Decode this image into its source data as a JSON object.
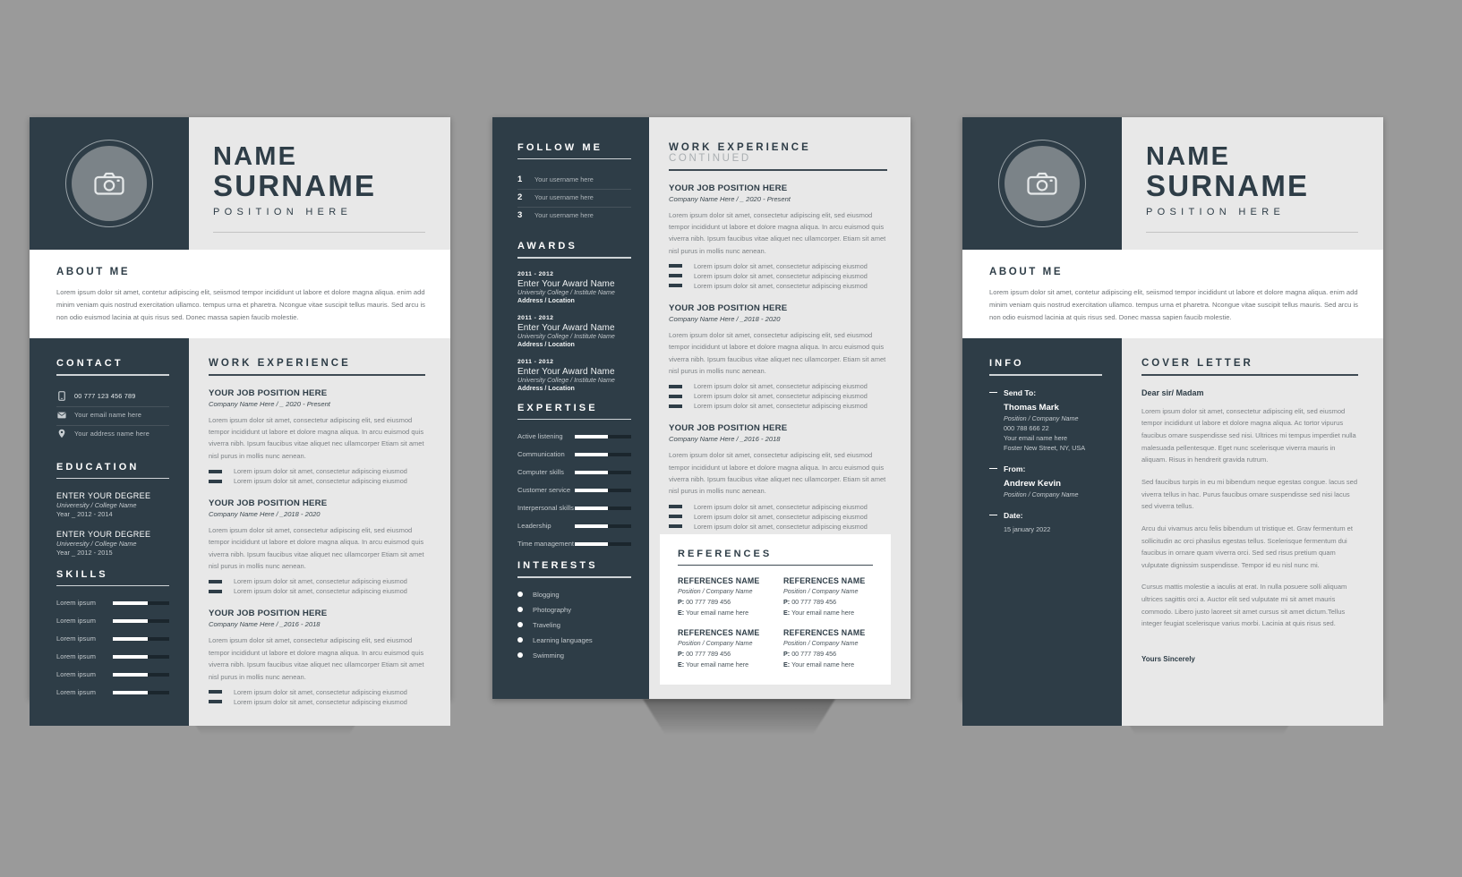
{
  "theme": {
    "dark": "#2e3d47",
    "light": "#e8e8e8",
    "white": "#ffffff",
    "background": "#9a9a9a",
    "accent_muted": "#7c8185"
  },
  "header": {
    "name_line1": "NAME",
    "name_line2": "SURNAME",
    "position": "POSITION HERE",
    "photo_icon": "camera-icon"
  },
  "about": {
    "title": "ABOUT ME",
    "body": "Lorem ipsum dolor sit amet, contetur adipiscing elit, seiismod tempor incididunt ut labore et dolore magna aliqua. enim add minim veniam quis nostrud exercitation ullamco. tempus urna et pharetra. Ncongue vitae suscipit tellus mauris. Sed arcu is non odio euismod lacinia at quis risus sed. Donec massa sapien faucib molestie."
  },
  "page1": {
    "contact": {
      "title": "CONTACT",
      "items": [
        {
          "icon": "phone-icon",
          "text": "00 777 123 456 789"
        },
        {
          "icon": "email-icon",
          "text": "Your email name here"
        },
        {
          "icon": "location-icon",
          "text": "Your address name here"
        }
      ]
    },
    "education": {
      "title": "EDUCATION",
      "items": [
        {
          "degree": "ENTER YOUR DEGREE",
          "school": "Univeresity / College Name",
          "year": "Year _ 2012 - 2014"
        },
        {
          "degree": "ENTER YOUR DEGREE",
          "school": "Univeresity / College Name",
          "year": "Year _ 2012 - 2015"
        }
      ]
    },
    "skills": {
      "title": "SKILLS",
      "items": [
        {
          "label": "Lorem ipsum",
          "value": 62
        },
        {
          "label": "Lorem ipsum",
          "value": 62
        },
        {
          "label": "Lorem ipsum",
          "value": 62
        },
        {
          "label": "Lorem ipsum",
          "value": 62
        },
        {
          "label": "Lorem ipsum",
          "value": 62
        },
        {
          "label": "Lorem ipsum",
          "value": 62
        }
      ]
    },
    "work": {
      "title": "WORK EXPERIENCE",
      "jobs": [
        {
          "title": "YOUR JOB POSITION HERE",
          "meta": "Company Name Here / _ 2020 - Present",
          "body": "Lorem ipsum dolor sit amet, consectetur adipiscing elit, sed eiusmod tempor incididunt ut labore et dolore magna aliqua. In arcu  euismod quis viverra nibh. Ipsum faucibus vitae aliquet nec ullamcorper Etiam sit amet nisl purus in mollis nunc aenean.",
          "bullets": [
            "Lorem ipsum dolor sit amet, consectetur adipiscing eiusmod",
            "Lorem ipsum dolor sit amet, consectetur adipiscing eiusmod"
          ]
        },
        {
          "title": "YOUR JOB POSITION HERE",
          "meta": "Company Name Here / _2018 - 2020",
          "body": "Lorem ipsum dolor sit amet, consectetur adipiscing elit, sed eiusmod tempor incididunt ut labore et dolore magna aliqua. In arcu  euismod quis viverra nibh. Ipsum faucibus vitae aliquet nec ullamcorper Etiam sit amet nisl purus in mollis nunc aenean.",
          "bullets": [
            "Lorem ipsum dolor sit amet, consectetur adipiscing eiusmod",
            "Lorem ipsum dolor sit amet, consectetur adipiscing eiusmod"
          ]
        },
        {
          "title": "YOUR JOB POSITION HERE",
          "meta": "Company Name Here / _2016 - 2018",
          "body": "Lorem ipsum dolor sit amet, consectetur adipiscing elit, sed eiusmod tempor incididunt ut labore et dolore magna aliqua. In arcu  euismod quis viverra nibh. Ipsum faucibus vitae aliquet nec ullamcorper Etiam sit amet nisl purus in mollis nunc aenean.",
          "bullets": [
            "Lorem ipsum dolor sit amet, consectetur adipiscing eiusmod",
            "Lorem ipsum dolor sit amet, consectetur adipiscing eiusmod"
          ]
        }
      ]
    }
  },
  "page2": {
    "follow": {
      "title": "FOLLOW ME",
      "items": [
        {
          "num": "1",
          "text": "Your username here"
        },
        {
          "num": "2",
          "text": "Your username here"
        },
        {
          "num": "3",
          "text": "Your username here"
        }
      ]
    },
    "awards": {
      "title": "AWARDS",
      "items": [
        {
          "years": "2011 - 2012",
          "name": "Enter Your Award Name",
          "school": "University  College / Institute Name",
          "location": "Address / Location"
        },
        {
          "years": "2011 - 2012",
          "name": "Enter Your Award Name",
          "school": "University  College / Institute Name",
          "location": "Address / Location"
        },
        {
          "years": "2011 - 2012",
          "name": "Enter Your Award Name",
          "school": "University  College / Institute Name",
          "location": "Address / Location"
        }
      ]
    },
    "expertise": {
      "title": "EXPERTISE",
      "items": [
        {
          "label": "Active listening",
          "value": 58
        },
        {
          "label": "Communication",
          "value": 58
        },
        {
          "label": "Computer skills",
          "value": 58
        },
        {
          "label": "Customer service",
          "value": 58
        },
        {
          "label": "Interpersonal skills",
          "value": 58
        },
        {
          "label": "Leadership",
          "value": 58
        },
        {
          "label": "Time management",
          "value": 58
        }
      ]
    },
    "interests": {
      "title": "INTERESTS",
      "items": [
        "Blogging",
        "Photography",
        "Traveling",
        "Learning languages",
        "Swimming"
      ]
    },
    "work": {
      "title": "WORK EXPERIENCE",
      "title_suffix": "CONTINUED",
      "jobs": [
        {
          "title": "YOUR JOB POSITION HERE",
          "meta": "Company Name Here / _ 2020 - Present",
          "body": "Lorem ipsum dolor sit amet, consectetur adipiscing elit, sed eiusmod tempor incididunt ut labore et dolore magna aliqua. In arcu  euismod quis viverra nibh. Ipsum faucibus vitae aliquet nec ullamcorper. Etiam sit amet nisl purus in mollis nunc aenean.",
          "bullets": [
            "Lorem ipsum dolor sit amet, consectetur adipiscing eiusmod",
            "Lorem ipsum dolor sit amet, consectetur adipiscing eiusmod",
            "Lorem ipsum dolor sit amet, consectetur adipiscing eiusmod"
          ]
        },
        {
          "title": "YOUR JOB POSITION HERE",
          "meta": "Company Name Here / _2018 - 2020",
          "body": "Lorem ipsum dolor sit amet, consectetur adipiscing elit, sed eiusmod tempor incididunt ut labore et dolore magna aliqua. In arcu  euismod quis viverra nibh. Ipsum faucibus vitae aliquet nec ullamcorper. Etiam sit amet nisl purus in mollis nunc aenean.",
          "bullets": [
            "Lorem ipsum dolor sit amet, consectetur adipiscing eiusmod",
            "Lorem ipsum dolor sit amet, consectetur adipiscing eiusmod",
            "Lorem ipsum dolor sit amet, consectetur adipiscing eiusmod"
          ]
        },
        {
          "title": "YOUR JOB POSITION HERE",
          "meta": "Company Name Here / _2016 - 2018",
          "body": "Lorem ipsum dolor sit amet, consectetur adipiscing elit, sed eiusmod tempor incididunt ut labore et dolore magna aliqua. In arcu  euismod quis viverra nibh. Ipsum faucibus vitae aliquet nec ullamcorper. Etiam sit amet nisl purus in mollis nunc aenean.",
          "bullets": [
            "Lorem ipsum dolor sit amet, consectetur adipiscing eiusmod",
            "Lorem ipsum dolor sit amet, consectetur adipiscing eiusmod",
            "Lorem ipsum dolor sit amet, consectetur adipiscing eiusmod"
          ]
        }
      ]
    },
    "references": {
      "title": "REFERENCES",
      "items": [
        {
          "name": "REFERENCES NAME",
          "position": "Position / Company Name",
          "phone_label": "P:",
          "phone": "00 777 789 456",
          "email_label": "E:",
          "email": "Your email name here"
        },
        {
          "name": "REFERENCES NAME",
          "position": "Position / Company Name",
          "phone_label": "P:",
          "phone": "00 777 789 456",
          "email_label": "E:",
          "email": "Your email name here"
        },
        {
          "name": "REFERENCES NAME",
          "position": "Position / Company Name",
          "phone_label": "P:",
          "phone": "00 777 789 456",
          "email_label": "E:",
          "email": "Your email name here"
        },
        {
          "name": "REFERENCES NAME",
          "position": "Position / Company Name",
          "phone_label": "P:",
          "phone": "00 777 789 456",
          "email_label": "E:",
          "email": "Your email name here"
        }
      ]
    }
  },
  "page3": {
    "info": {
      "title": "INFO",
      "send_to_label": "Send To:",
      "send_to_name": "Thomas Mark",
      "send_to_position": "Position / Company Name",
      "send_to_phone": "000 788 666 22",
      "send_to_email": "Your email name here",
      "send_to_address": "Foster New Street, NY, USA",
      "from_label": "From:",
      "from_name": "Andrew Kevin",
      "from_position": "Position / Company Name",
      "date_label": "Date:",
      "date_value": "15  january 2022"
    },
    "cover": {
      "title": "COVER LETTER",
      "greeting": "Dear sir/ Madam",
      "paragraphs": [
        "Lorem ipsum dolor sit amet, consectetur adipiscing elit, sed eiusmod tempor incididunt ut labore et dolore magna aliqua. Ac tortor vipurus faucibus ornare suspendisse sed nisi. Ultrices mi tempus imperdiet nulla malesuada pellentesque. Eget nunc scelerisque viverra mauris in aliquam. Risus in hendrerit gravida rutrum.",
        "Sed faucibus turpis in eu mi bibendum neque egestas congue. lacus sed viverra tellus in hac. Purus faucibus ornare suspendisse sed nisi lacus sed viverra tellus.",
        "Arcu dui vivamus arcu felis bibendum ut tristique et. Grav fermentum et sollicitudin ac orci phasilus egestas tellus. Scelerisque fermentum dui faucibus in ornare quam viverra orci. Sed sed risus pretium quam vulputate dignissim suspendisse. Tempor id eu nisl nunc mi.",
        "Cursus mattis molestie a iaculis at erat. In nulla posuere solli aliquam ultrices sagittis orci a. Auctor elit sed vulputate mi sit amet mauris commodo. Libero justo laoreet sit amet cursus sit amet dictum.Tellus integer feugiat scelerisque varius morbi. Lacinia at quis risus sed."
      ],
      "signature": "Yours Sincerely"
    }
  }
}
